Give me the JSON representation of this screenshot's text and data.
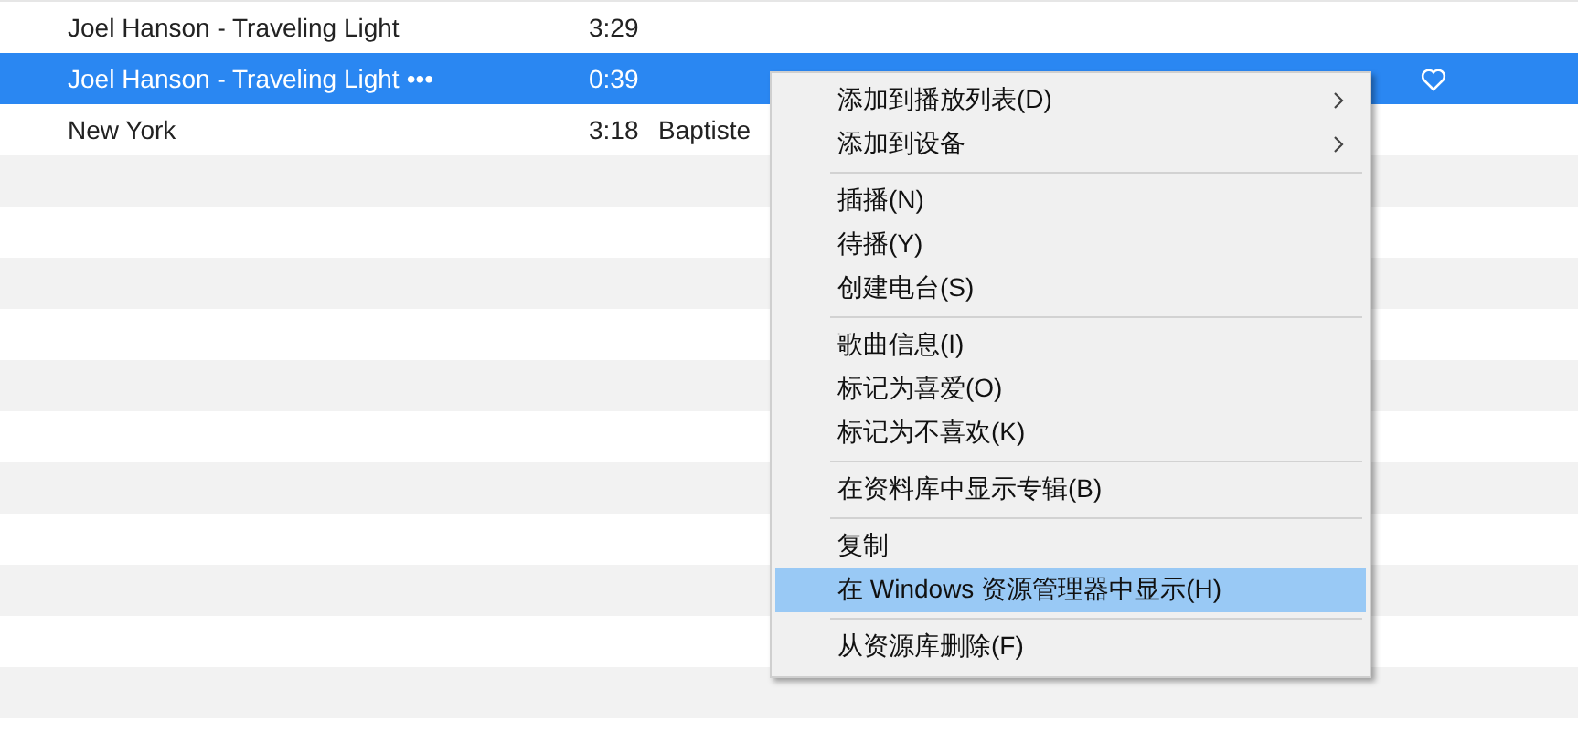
{
  "tracks": [
    {
      "title": "Joel Hanson - Traveling Light",
      "time": "3:29",
      "favorite_icon": false,
      "selected": false
    },
    {
      "title": "Joel Hanson - Traveling Light",
      "more": "•••",
      "time": "0:39",
      "favorite_icon": true,
      "selected": true
    },
    {
      "title": "New York",
      "time": "3:18",
      "artist": "Baptiste",
      "favorite_icon": false,
      "selected": false
    }
  ],
  "context_menu": [
    {
      "kind": "item",
      "label": "添加到播放列表(D)",
      "submenu": true,
      "selected": false
    },
    {
      "kind": "item",
      "label": "添加到设备",
      "submenu": true,
      "selected": false
    },
    {
      "kind": "separator"
    },
    {
      "kind": "item",
      "label": "插播(N)",
      "submenu": false,
      "selected": false
    },
    {
      "kind": "item",
      "label": "待播(Y)",
      "submenu": false,
      "selected": false
    },
    {
      "kind": "item",
      "label": "创建电台(S)",
      "submenu": false,
      "selected": false
    },
    {
      "kind": "separator"
    },
    {
      "kind": "item",
      "label": "歌曲信息(I)",
      "submenu": false,
      "selected": false
    },
    {
      "kind": "item",
      "label": "标记为喜爱(O)",
      "submenu": false,
      "selected": false
    },
    {
      "kind": "item",
      "label": "标记为不喜欢(K)",
      "submenu": false,
      "selected": false
    },
    {
      "kind": "separator"
    },
    {
      "kind": "item",
      "label": "在资料库中显示专辑(B)",
      "submenu": false,
      "selected": false
    },
    {
      "kind": "separator"
    },
    {
      "kind": "item",
      "label": "复制",
      "submenu": false,
      "selected": false
    },
    {
      "kind": "item",
      "label": "在 Windows 资源管理器中显示(H)",
      "submenu": false,
      "selected": true
    },
    {
      "kind": "separator"
    },
    {
      "kind": "item",
      "label": "从资源库删除(F)",
      "submenu": false,
      "selected": false
    }
  ]
}
